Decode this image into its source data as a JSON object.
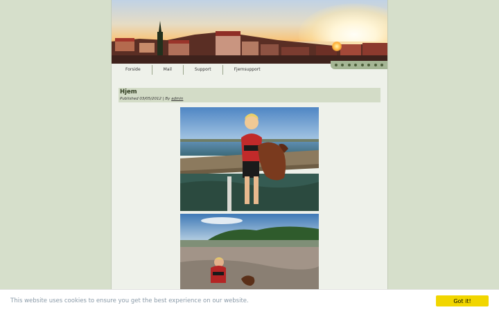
{
  "navigation": {
    "items": [
      {
        "label": "Forside"
      },
      {
        "label": "Mail"
      },
      {
        "label": "Support"
      },
      {
        "label": "Fjernsupport"
      }
    ]
  },
  "post": {
    "title": "Hjem",
    "meta_prefix": "Published 03/05/2012 | By",
    "author": "admin"
  },
  "cookie_banner": {
    "message": "This website uses cookies to ensure you get the best experience on our website.",
    "button_label": "Got it!"
  },
  "colors": {
    "page_background": "#d6dfcb",
    "content_background": "#eef1ea",
    "post_header_background": "#d3dcc7",
    "cookie_button": "#f1d600"
  }
}
